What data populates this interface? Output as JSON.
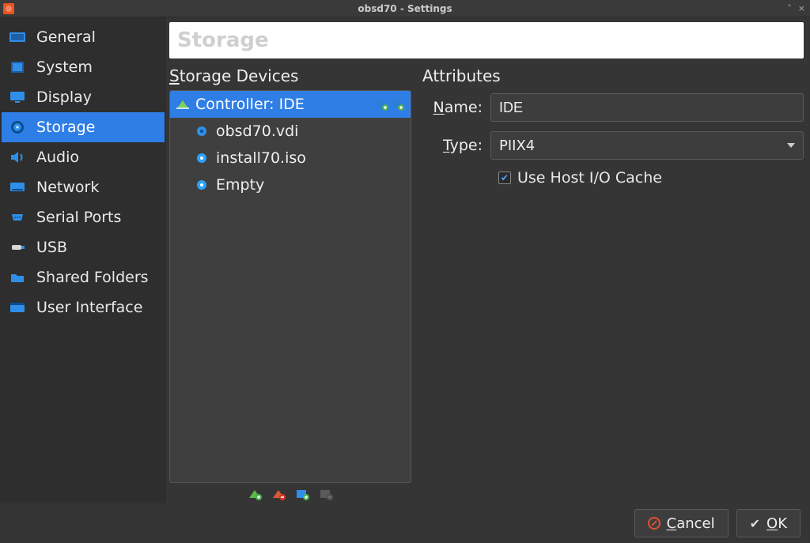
{
  "window": {
    "title": "obsd70 - Settings"
  },
  "sidebar": {
    "items": [
      {
        "label": "General",
        "selected": false
      },
      {
        "label": "System",
        "selected": false
      },
      {
        "label": "Display",
        "selected": false
      },
      {
        "label": "Storage",
        "selected": true
      },
      {
        "label": "Audio",
        "selected": false
      },
      {
        "label": "Network",
        "selected": false
      },
      {
        "label": "Serial Ports",
        "selected": false
      },
      {
        "label": "USB",
        "selected": false
      },
      {
        "label": "Shared Folders",
        "selected": false
      },
      {
        "label": "User Interface",
        "selected": false
      }
    ]
  },
  "banner": {
    "title": "Storage"
  },
  "storage": {
    "section_label": "Storage Devices",
    "controller": {
      "label": "Controller: IDE"
    },
    "items": [
      {
        "label": "obsd70.vdi",
        "kind": "hdd"
      },
      {
        "label": "install70.iso",
        "kind": "cd"
      },
      {
        "label": "Empty",
        "kind": "cd"
      }
    ]
  },
  "attributes": {
    "section_label": "Attributes",
    "name_label": "Name:",
    "name_value": "IDE",
    "type_label": "Type:",
    "type_value": "PIIX4",
    "cache_label": "Use Host I/O Cache",
    "cache_checked": true
  },
  "footer": {
    "cancel_label": "Cancel",
    "ok_label": "OK"
  }
}
